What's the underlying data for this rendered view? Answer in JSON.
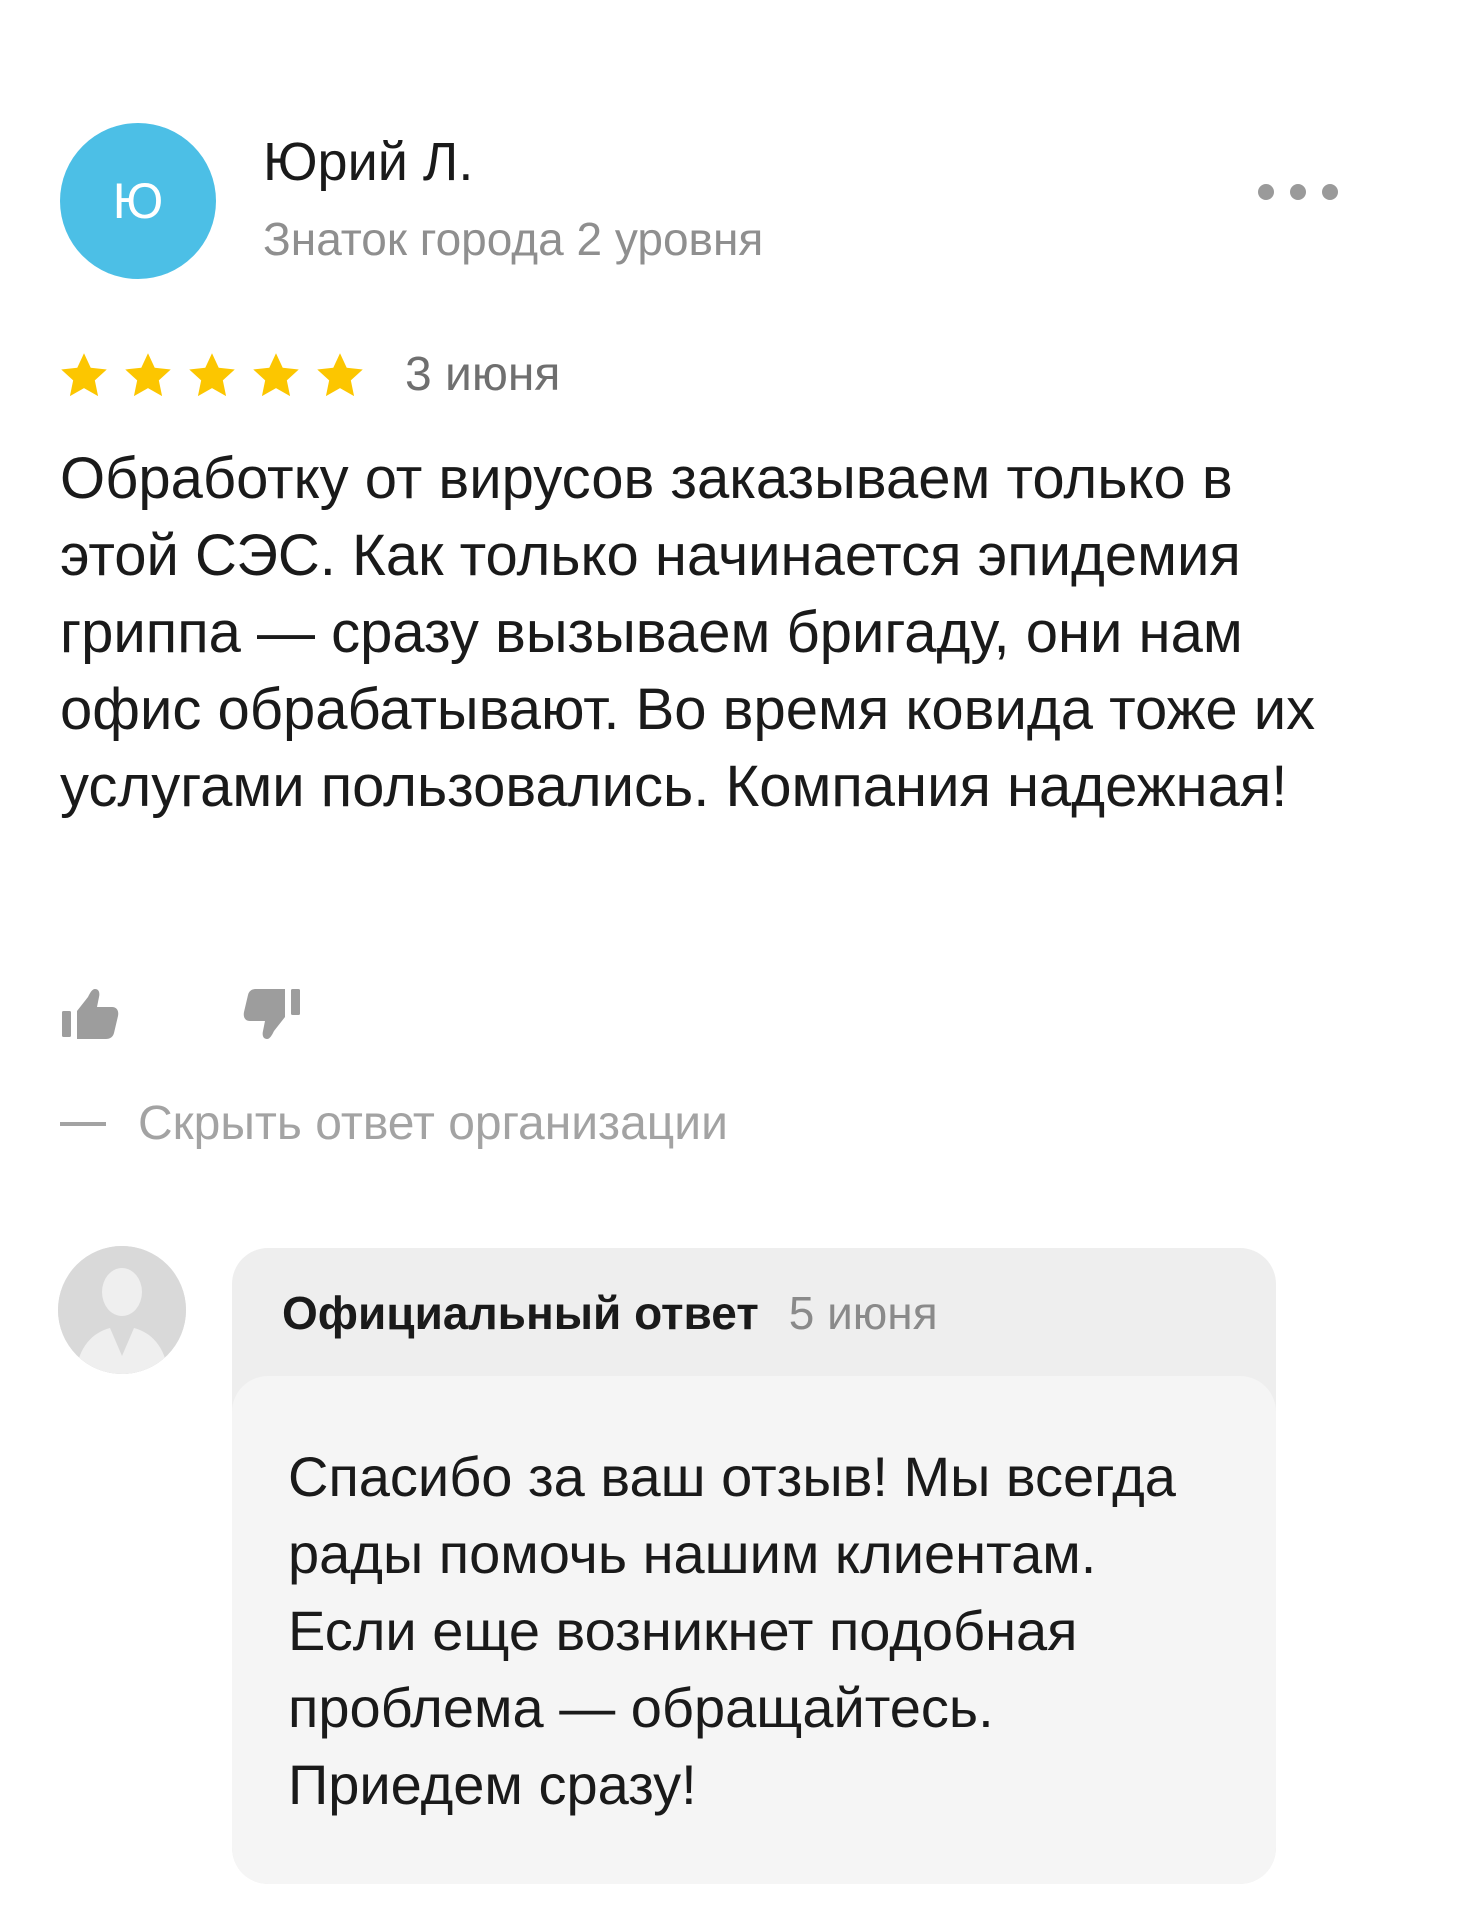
{
  "review": {
    "author": {
      "initial": "Ю",
      "name": "Юрий Л.",
      "level": "Знаток города 2 уровня",
      "avatar_color": "#4cbfe6"
    },
    "rating": {
      "stars": 5,
      "max": 5,
      "color": "#fcc600"
    },
    "date": "3 июня",
    "text": "Обработку от вирусов заказываем только в этой СЭС. Как только начинается эпидемия гриппа — сразу вызываем бригаду, они нам офис обрабатывают. Во время ковида тоже их услугами пользовались. Компания надежная!",
    "actions": {
      "like_icon": "thumbs-up-icon",
      "dislike_icon": "thumbs-down-icon",
      "more_icon": "more-dots-icon"
    },
    "hide_reply_label": "Скрыть ответ организации"
  },
  "official_reply": {
    "title": "Официальный ответ",
    "date": "5 июня",
    "text": "Спасибо за ваш отзыв! Мы всегда рады помочь нашим клиентам. Если еще возникнет подобная проблема — обращайтесь. Приедем сразу!",
    "avatar_icon": "person-silhouette-icon"
  }
}
